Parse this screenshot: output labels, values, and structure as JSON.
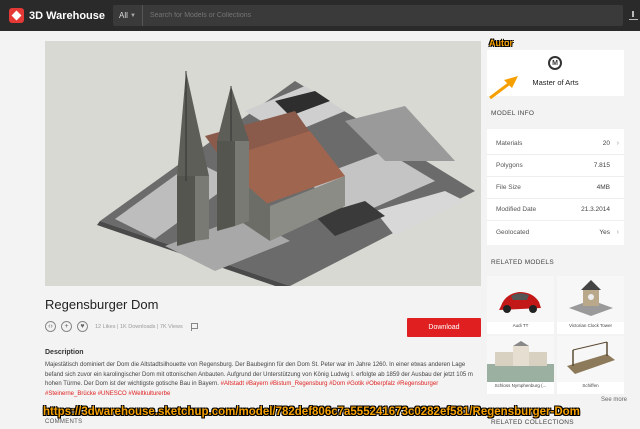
{
  "header": {
    "app_name": "3D Warehouse",
    "scope": "All",
    "search_placeholder": "Search for Models or Collections"
  },
  "model": {
    "title": "Regensburger Dom",
    "stats": "12 Likes | 1K Downloads | 7K Views",
    "download_label": "Download",
    "description_heading": "Description",
    "description_text": "Majestätisch dominiert der Dom die Altstadtsilhouette von Regensburg. Der Baubeginn für den Dom St. Peter war im Jahre 1260. In einer etwas anderen Lage befand sich zuvor ein karolingischer Dom mit ottonischen Anbauten. Aufgrund der Unterstützung von König Ludwig I. erfolgte ab 1859 der Ausbau der jetzt 105 m hohen Türme. Der Dom ist der wichtigste gotische Bau in Bayern.",
    "tags": [
      "#Altstadt",
      "#Bayern",
      "#Bistum_Regensburg",
      "#Dom",
      "#Gotik",
      "#Oberpfalz",
      "#Regensburger",
      "#Steinerne_Brücke",
      "#UNESCO",
      "#Weltkulturerbe"
    ],
    "comments_heading": "COMMENTS"
  },
  "author": {
    "name": "Master of Arts"
  },
  "model_info": {
    "heading": "MODEL INFO",
    "rows": [
      {
        "label": "Materials",
        "value": "20"
      },
      {
        "label": "Polygons",
        "value": "7.815"
      },
      {
        "label": "File Size",
        "value": "4MB"
      },
      {
        "label": "Modified Date",
        "value": "21.3.2014"
      },
      {
        "label": "Geolocated",
        "value": "Yes"
      }
    ]
  },
  "related_models": {
    "heading": "RELATED MODELS",
    "items": [
      {
        "name": "Audi TT"
      },
      {
        "name": "Victorian Clock Tower"
      },
      {
        "name": "Schloss Nymphenburg (..."
      },
      {
        "name": "Schiffen"
      }
    ],
    "see_more": "See more"
  },
  "related_collections": {
    "heading": "RELATED COLLECTIONS"
  },
  "annotations": {
    "autor_label": "Autor",
    "url": "https://3dwarehouse.sketchup.com/model/782def806c7a555241673c0282ef581/Regensburger-Dom"
  }
}
